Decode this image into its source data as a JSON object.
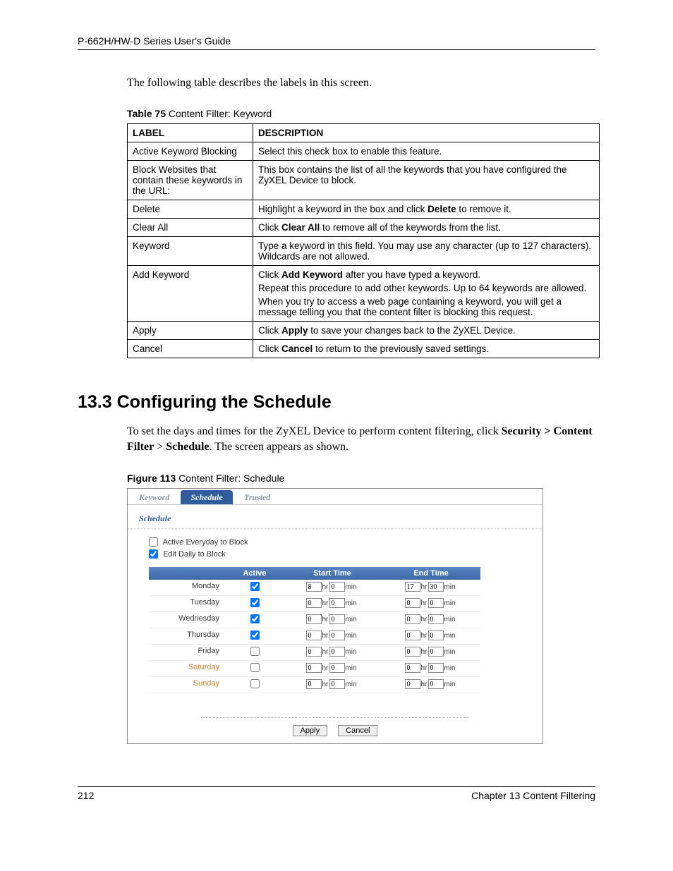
{
  "header": "P-662H/HW-D Series User's Guide",
  "intro": "The following table describes the labels in this screen.",
  "table_caption_bold": "Table 75",
  "table_caption_rest": "   Content Filter: Keyword",
  "table": {
    "headers": [
      "LABEL",
      "DESCRIPTION"
    ],
    "rows": [
      {
        "label": "Active Keyword Blocking",
        "desc": [
          {
            "t": "Select this check box to enable this feature."
          }
        ]
      },
      {
        "label": "Block Websites that contain these keywords in the URL:",
        "desc": [
          {
            "t": "This box contains the list of all the keywords that you have configured the ZyXEL Device to block."
          }
        ]
      },
      {
        "label": "Delete",
        "desc": [
          {
            "pre": "Highlight a keyword in the box and click ",
            "b": "Delete",
            "post": " to remove it."
          }
        ]
      },
      {
        "label": "Clear All",
        "desc": [
          {
            "pre": "Click ",
            "b": "Clear All",
            "post": " to remove all of the keywords from the list."
          }
        ]
      },
      {
        "label": "Keyword",
        "desc": [
          {
            "t": "Type a keyword in this field. You may use any character (up to 127 characters). Wildcards are not allowed."
          }
        ]
      },
      {
        "label": "Add Keyword",
        "desc": [
          {
            "pre": "Click ",
            "b": "Add Keyword",
            "post": " after you have typed a keyword."
          },
          {
            "t": "Repeat this procedure to add other keywords. Up to 64 keywords are allowed."
          },
          {
            "t": "When you try to access a web page containing a keyword, you will get a message telling you that the content filter is blocking this request."
          }
        ]
      },
      {
        "label": "Apply",
        "desc": [
          {
            "pre": "Click ",
            "b": "Apply",
            "post": " to save your changes back to the ZyXEL Device."
          }
        ]
      },
      {
        "label": "Cancel",
        "desc": [
          {
            "pre": "Click ",
            "b": "Cancel",
            "post": " to return to the previously saved settings."
          }
        ]
      }
    ]
  },
  "section_title": "13.3  Configuring the Schedule",
  "section_body_pre": "To set the days and times for the ZyXEL Device to perform content filtering, click ",
  "section_body_b1": "Security > Content Filter",
  "section_body_mid": " > ",
  "section_body_b2": "Schedule",
  "section_body_post": ". The screen appears as shown.",
  "figure_caption_bold": "Figure 113",
  "figure_caption_rest": "   Content Filter: Schedule",
  "ui": {
    "tabs": [
      "Keyword",
      "Schedule",
      "Trusted"
    ],
    "section_label": "Schedule",
    "cb1": "Active Everyday to Block",
    "cb2": "Edit Daily to Block",
    "cols": {
      "day": "",
      "active": "Active",
      "start": "Start Time",
      "end": "End Time"
    },
    "hr": "hr",
    "min": "min",
    "days": [
      {
        "name": "Monday",
        "active": true,
        "sh": "8",
        "sm": "0",
        "eh": "17",
        "em": "30",
        "weekend": false
      },
      {
        "name": "Tuesday",
        "active": true,
        "sh": "0",
        "sm": "0",
        "eh": "0",
        "em": "0",
        "weekend": false
      },
      {
        "name": "Wednesday",
        "active": true,
        "sh": "0",
        "sm": "0",
        "eh": "0",
        "em": "0",
        "weekend": false
      },
      {
        "name": "Thursday",
        "active": true,
        "sh": "0",
        "sm": "0",
        "eh": "0",
        "em": "0",
        "weekend": false
      },
      {
        "name": "Friday",
        "active": false,
        "sh": "0",
        "sm": "0",
        "eh": "0",
        "em": "0",
        "weekend": false
      },
      {
        "name": "Saturday",
        "active": false,
        "sh": "0",
        "sm": "0",
        "eh": "0",
        "em": "0",
        "weekend": true
      },
      {
        "name": "Sunday",
        "active": false,
        "sh": "0",
        "sm": "0",
        "eh": "0",
        "em": "0",
        "weekend": true
      }
    ],
    "apply": "Apply",
    "cancel": "Cancel"
  },
  "footer": {
    "page": "212",
    "chapter": "Chapter 13 Content Filtering"
  }
}
